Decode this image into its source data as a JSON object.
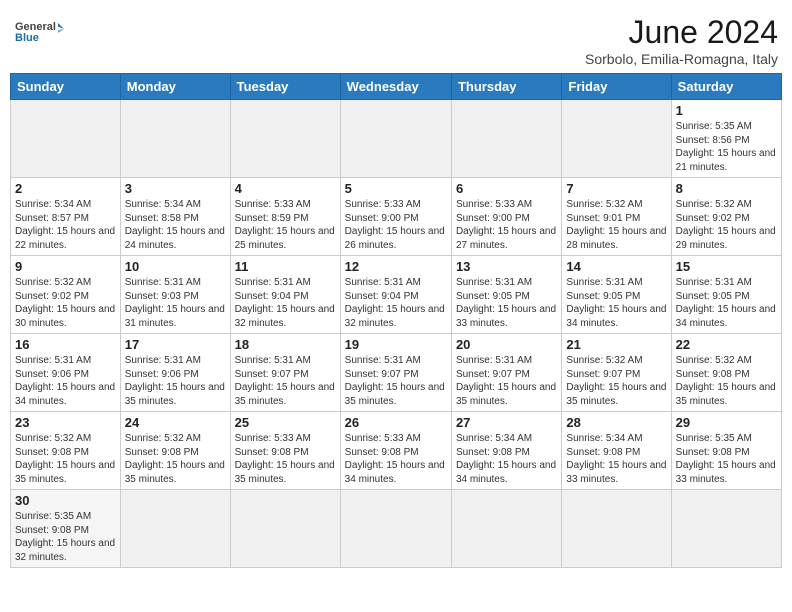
{
  "logo": {
    "text_general": "General",
    "text_blue": "Blue"
  },
  "header": {
    "month": "June 2024",
    "location": "Sorbolo, Emilia-Romagna, Italy"
  },
  "weekdays": [
    "Sunday",
    "Monday",
    "Tuesday",
    "Wednesday",
    "Thursday",
    "Friday",
    "Saturday"
  ],
  "weeks": [
    [
      {
        "day": "",
        "info": ""
      },
      {
        "day": "",
        "info": ""
      },
      {
        "day": "",
        "info": ""
      },
      {
        "day": "",
        "info": ""
      },
      {
        "day": "",
        "info": ""
      },
      {
        "day": "",
        "info": ""
      },
      {
        "day": "1",
        "info": "Sunrise: 5:35 AM\nSunset: 8:56 PM\nDaylight: 15 hours and 21 minutes."
      }
    ],
    [
      {
        "day": "2",
        "info": "Sunrise: 5:34 AM\nSunset: 8:57 PM\nDaylight: 15 hours and 22 minutes."
      },
      {
        "day": "3",
        "info": "Sunrise: 5:34 AM\nSunset: 8:58 PM\nDaylight: 15 hours and 24 minutes."
      },
      {
        "day": "4",
        "info": "Sunrise: 5:33 AM\nSunset: 8:59 PM\nDaylight: 15 hours and 25 minutes."
      },
      {
        "day": "5",
        "info": "Sunrise: 5:33 AM\nSunset: 9:00 PM\nDaylight: 15 hours and 26 minutes."
      },
      {
        "day": "6",
        "info": "Sunrise: 5:33 AM\nSunset: 9:00 PM\nDaylight: 15 hours and 27 minutes."
      },
      {
        "day": "7",
        "info": "Sunrise: 5:32 AM\nSunset: 9:01 PM\nDaylight: 15 hours and 28 minutes."
      },
      {
        "day": "8",
        "info": "Sunrise: 5:32 AM\nSunset: 9:02 PM\nDaylight: 15 hours and 29 minutes."
      }
    ],
    [
      {
        "day": "9",
        "info": "Sunrise: 5:32 AM\nSunset: 9:02 PM\nDaylight: 15 hours and 30 minutes."
      },
      {
        "day": "10",
        "info": "Sunrise: 5:31 AM\nSunset: 9:03 PM\nDaylight: 15 hours and 31 minutes."
      },
      {
        "day": "11",
        "info": "Sunrise: 5:31 AM\nSunset: 9:04 PM\nDaylight: 15 hours and 32 minutes."
      },
      {
        "day": "12",
        "info": "Sunrise: 5:31 AM\nSunset: 9:04 PM\nDaylight: 15 hours and 32 minutes."
      },
      {
        "day": "13",
        "info": "Sunrise: 5:31 AM\nSunset: 9:05 PM\nDaylight: 15 hours and 33 minutes."
      },
      {
        "day": "14",
        "info": "Sunrise: 5:31 AM\nSunset: 9:05 PM\nDaylight: 15 hours and 34 minutes."
      },
      {
        "day": "15",
        "info": "Sunrise: 5:31 AM\nSunset: 9:05 PM\nDaylight: 15 hours and 34 minutes."
      }
    ],
    [
      {
        "day": "16",
        "info": "Sunrise: 5:31 AM\nSunset: 9:06 PM\nDaylight: 15 hours and 34 minutes."
      },
      {
        "day": "17",
        "info": "Sunrise: 5:31 AM\nSunset: 9:06 PM\nDaylight: 15 hours and 35 minutes."
      },
      {
        "day": "18",
        "info": "Sunrise: 5:31 AM\nSunset: 9:07 PM\nDaylight: 15 hours and 35 minutes."
      },
      {
        "day": "19",
        "info": "Sunrise: 5:31 AM\nSunset: 9:07 PM\nDaylight: 15 hours and 35 minutes."
      },
      {
        "day": "20",
        "info": "Sunrise: 5:31 AM\nSunset: 9:07 PM\nDaylight: 15 hours and 35 minutes."
      },
      {
        "day": "21",
        "info": "Sunrise: 5:32 AM\nSunset: 9:07 PM\nDaylight: 15 hours and 35 minutes."
      },
      {
        "day": "22",
        "info": "Sunrise: 5:32 AM\nSunset: 9:08 PM\nDaylight: 15 hours and 35 minutes."
      }
    ],
    [
      {
        "day": "23",
        "info": "Sunrise: 5:32 AM\nSunset: 9:08 PM\nDaylight: 15 hours and 35 minutes."
      },
      {
        "day": "24",
        "info": "Sunrise: 5:32 AM\nSunset: 9:08 PM\nDaylight: 15 hours and 35 minutes."
      },
      {
        "day": "25",
        "info": "Sunrise: 5:33 AM\nSunset: 9:08 PM\nDaylight: 15 hours and 35 minutes."
      },
      {
        "day": "26",
        "info": "Sunrise: 5:33 AM\nSunset: 9:08 PM\nDaylight: 15 hours and 34 minutes."
      },
      {
        "day": "27",
        "info": "Sunrise: 5:34 AM\nSunset: 9:08 PM\nDaylight: 15 hours and 34 minutes."
      },
      {
        "day": "28",
        "info": "Sunrise: 5:34 AM\nSunset: 9:08 PM\nDaylight: 15 hours and 33 minutes."
      },
      {
        "day": "29",
        "info": "Sunrise: 5:35 AM\nSunset: 9:08 PM\nDaylight: 15 hours and 33 minutes."
      }
    ],
    [
      {
        "day": "30",
        "info": "Sunrise: 5:35 AM\nSunset: 9:08 PM\nDaylight: 15 hours and 32 minutes."
      },
      {
        "day": "",
        "info": ""
      },
      {
        "day": "",
        "info": ""
      },
      {
        "day": "",
        "info": ""
      },
      {
        "day": "",
        "info": ""
      },
      {
        "day": "",
        "info": ""
      },
      {
        "day": "",
        "info": ""
      }
    ]
  ]
}
